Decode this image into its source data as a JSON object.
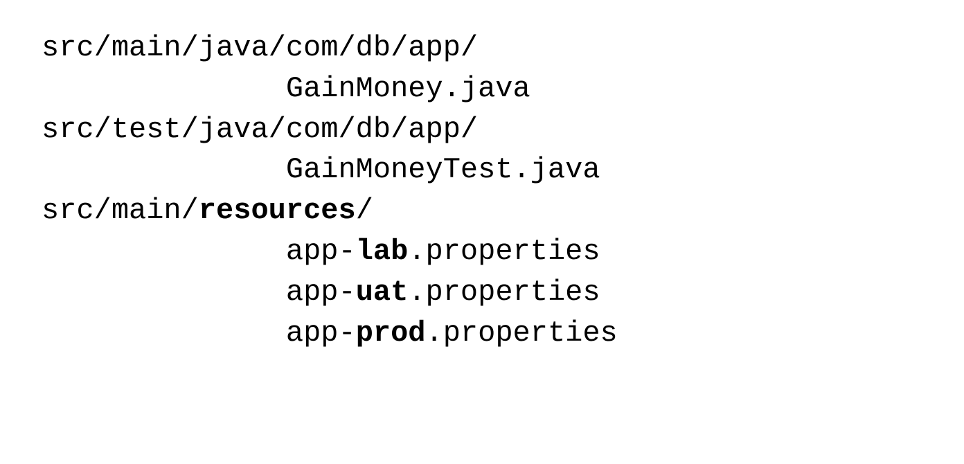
{
  "lines": {
    "l1": "src/main/java/com/db/app/",
    "l2_indent": "              ",
    "l2": "GainMoney.java",
    "l3": "src/test/java/com/db/app/",
    "l4_indent": "              ",
    "l4": "GainMoneyTest.java",
    "l5_prefix": "src/main/",
    "l5_bold": "resources",
    "l5_suffix": "/",
    "l6_indent": "              ",
    "l6_prefix": "app-",
    "l6_bold": "lab",
    "l6_suffix": ".properties",
    "l7_indent": "              ",
    "l7_prefix": "app-",
    "l7_bold": "uat",
    "l7_suffix": ".properties",
    "l8_indent": "              ",
    "l8_prefix": "app-",
    "l8_bold": "prod",
    "l8_suffix": ".properties"
  }
}
